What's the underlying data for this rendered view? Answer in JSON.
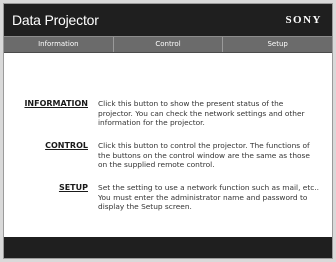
{
  "header": {
    "title": "Data Projector",
    "brand": "SONY"
  },
  "nav": {
    "tabs": [
      {
        "label": "Information"
      },
      {
        "label": "Control"
      },
      {
        "label": "Setup"
      }
    ]
  },
  "main": {
    "items": [
      {
        "link": "INFORMATION",
        "description": "Click this button to show the present status of the projector. You can check the network settings and other information for the projector."
      },
      {
        "link": "CONTROL",
        "description": "Click this button to control the projector. The functions of the buttons on the control window are the same as those on the supplied remote control."
      },
      {
        "link": "SETUP",
        "description": "Set the setting to use a network function such as mail, etc.. You must enter the administrator name and password to display the Setup screen."
      }
    ]
  }
}
